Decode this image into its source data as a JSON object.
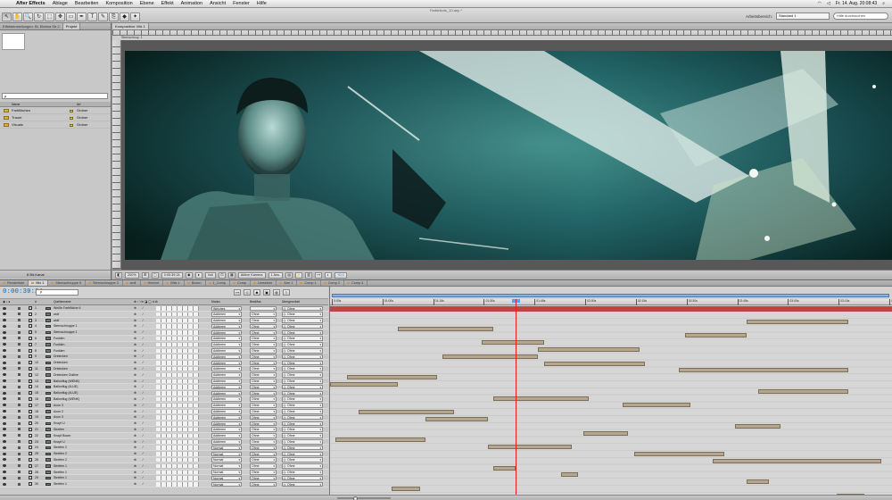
{
  "menubar": {
    "apple": "",
    "items": [
      "After Effects",
      "Ablage",
      "Bearbeiten",
      "Komposition",
      "Ebene",
      "Effekt",
      "Animation",
      "Ansicht",
      "Fenster",
      "Hilfe"
    ],
    "clock": "Fr. 14. Aug. 20:08:43"
  },
  "toolbar": {
    "doc_title": "Farbtrikots_10.aep *",
    "workspace_label": "Arbeitsbereich:",
    "workspace_value": "Standard 1",
    "search_placeholder": "Hilfe durchsuchen",
    "tools": [
      "↖",
      "✋",
      "🔍",
      "↻",
      "⬚",
      "✥",
      "▭",
      "✒",
      "T",
      "✎",
      "⎘",
      "◆",
      "✦"
    ]
  },
  "project": {
    "tabs": [
      "Effekteinstellungen: Bl. Elektra Str 2",
      "Projekt"
    ],
    "search_value": "ρ",
    "col_name": "Name",
    "col_type": "Art",
    "items": [
      {
        "name": "Farbflächen",
        "type": "Ordner"
      },
      {
        "name": "Trauer",
        "type": "Ordner"
      },
      {
        "name": "Visuals",
        "type": "Ordner"
      }
    ],
    "footer_bits": "8 Bit-Kanal"
  },
  "comp": {
    "tabs": [
      "Komposition: Mix 1"
    ],
    "subtab": "Sternschnup. 1",
    "footer": {
      "zoom": "200%",
      "timecode": "0:00:39:24",
      "resolution": "Voll",
      "camera": "Aktive Kamera",
      "views": "1 Ans.",
      "exposure": "+0,0"
    }
  },
  "timeline": {
    "tabs": [
      "Renderliste",
      "Mix 1",
      "Sternschnuppe 5",
      "Sternschnuppe 3",
      "wolf",
      "Himmel",
      "Blitz 1",
      "Boxen",
      "1_Comp",
      "Comp",
      "Umsetzer",
      "Arm 1",
      "Comp 1",
      "Comp 2",
      "Comp 3"
    ],
    "timecode": "0:00:39:24",
    "search_placeholder": "ρ",
    "col_headers": {
      "av": "",
      "num": "#",
      "name": "Quellenname",
      "switches": "⊕ ⋆ \\ fx ◪ ◯ ⊙ ⧉",
      "mode": "Modus",
      "trkmat": "BewMas",
      "parent": "Übergeordnet"
    },
    "layers": [
      {
        "num": "1",
        "name": "Weiße Farbfläche 6",
        "mode": "Weiches",
        "ttm": "",
        "parent": "Ohne"
      },
      {
        "num": "2",
        "name": "wolf",
        "mode": "Addieren",
        "ttm": "Ohne",
        "parent": "Ohne"
      },
      {
        "num": "3",
        "name": "wolf",
        "mode": "Addieren",
        "ttm": "Ohne",
        "parent": "Ohne"
      },
      {
        "num": "4",
        "name": "Sternschnuppe 1",
        "mode": "Addieren",
        "ttm": "Ohne",
        "parent": "Ohne"
      },
      {
        "num": "5",
        "name": "Sternschnuppe 1",
        "mode": "Addieren",
        "ttm": "Ohne",
        "parent": "Ohne"
      },
      {
        "num": "6",
        "name": "Funklen",
        "mode": "Addieren",
        "ttm": "Ohne",
        "parent": "Ohne"
      },
      {
        "num": "7",
        "name": "Funklen",
        "mode": "Addieren",
        "ttm": "Ohne",
        "parent": "Ohne"
      },
      {
        "num": "8",
        "name": "Funklen",
        "mode": "Addieren",
        "ttm": "Ohne",
        "parent": "Ohne"
      },
      {
        "num": "9",
        "name": "Dreiecken",
        "mode": "Addieren",
        "ttm": "Ohne",
        "parent": "Ohne"
      },
      {
        "num": "10",
        "name": "Dreiecken",
        "mode": "Addieren",
        "ttm": "Ohne",
        "parent": "Ohne"
      },
      {
        "num": "11",
        "name": "Dreiecken",
        "mode": "Addieren",
        "ttm": "Ohne",
        "parent": "Ohne"
      },
      {
        "num": "12",
        "name": "Dreiecken Outline",
        "mode": "Addieren",
        "ttm": "Ohne",
        "parent": "Ohne"
      },
      {
        "num": "13",
        "name": "Ballonflug (WENK)",
        "mode": "Addieren",
        "ttm": "Ohne",
        "parent": "Ohne"
      },
      {
        "num": "14",
        "name": "Ballonflug (4LUE)",
        "mode": "Addieren",
        "ttm": "Ohne",
        "parent": "Ohne"
      },
      {
        "num": "15",
        "name": "Ballonflug (4LUE)",
        "mode": "Addieren",
        "ttm": "Ohne",
        "parent": "Ohne"
      },
      {
        "num": "16",
        "name": "Ballonflug (WENK)",
        "mode": "Addieren",
        "ttm": "Ohne",
        "parent": "Ohne"
      },
      {
        "num": "17",
        "name": "Acon 3",
        "mode": "Addieren",
        "ttm": "Ohne",
        "parent": "Ohne"
      },
      {
        "num": "18",
        "name": "Acon 2",
        "mode": "Addieren",
        "ttm": "Ohne",
        "parent": "Ohne"
      },
      {
        "num": "19",
        "name": "Acon 3",
        "mode": "Addieren",
        "ttm": "Ohne",
        "parent": "Ohne"
      },
      {
        "num": "20",
        "name": "Knopf U",
        "mode": "Addieren",
        "ttm": "Ohne",
        "parent": "Ohne"
      },
      {
        "num": "21",
        "name": "Streifen",
        "mode": "Addieren",
        "ttm": "Ohne",
        "parent": "Ohne"
      },
      {
        "num": "22",
        "name": "Knopf Boom",
        "mode": "Addieren",
        "ttm": "Ohne",
        "parent": "Ohne"
      },
      {
        "num": "23",
        "name": "Knopf U",
        "mode": "Addieren",
        "ttm": "Ohne",
        "parent": "Ohne"
      },
      {
        "num": "24",
        "name": "Streifen 2",
        "mode": "Normal",
        "ttm": "Ohne",
        "parent": "Ohne"
      },
      {
        "num": "25",
        "name": "Streifen 2",
        "mode": "Normal",
        "ttm": "Ohne",
        "parent": "Ohne"
      },
      {
        "num": "26",
        "name": "Streifen 2",
        "mode": "Normal",
        "ttm": "Ohne",
        "parent": "Ohne"
      },
      {
        "num": "27",
        "name": "Streifen 1",
        "mode": "Normal",
        "ttm": "Ohne",
        "parent": "Ohne"
      },
      {
        "num": "28",
        "name": "Streifen 1",
        "mode": "Normal",
        "ttm": "Ohne",
        "parent": "Ohne"
      },
      {
        "num": "29",
        "name": "Streifen 1",
        "mode": "Normal",
        "ttm": "Ohne",
        "parent": "Ohne"
      },
      {
        "num": "30",
        "name": "Streifen 1",
        "mode": "Normal",
        "ttm": "Ohne",
        "parent": "Ohne"
      }
    ],
    "ruler_ticks": [
      "0:00s",
      "01:00s",
      "01:15s",
      "01:30s",
      "01:45s",
      "02:00s",
      "02:15s",
      "02:30s",
      "02:45s",
      "03:00s",
      "03:15s",
      "03:30s"
    ],
    "tracks": [
      {
        "s": 0.0,
        "e": 1.0,
        "active": true
      },
      {
        "s": 0.74,
        "e": 0.92
      },
      {
        "s": 0.12,
        "e": 0.29
      },
      {
        "s": 0.63,
        "e": 0.74
      },
      {
        "s": 0.27,
        "e": 0.38
      },
      {
        "s": 0.37,
        "e": 0.55
      },
      {
        "s": 0.2,
        "e": 0.37
      },
      {
        "s": 0.38,
        "e": 0.56
      },
      {
        "s": 0.62,
        "e": 0.92
      },
      {
        "s": 0.03,
        "e": 0.19
      },
      {
        "s": 0.0,
        "e": 0.12
      },
      {
        "s": 0.76,
        "e": 0.92
      },
      {
        "s": 0.29,
        "e": 0.46
      },
      {
        "s": 0.52,
        "e": 0.64
      },
      {
        "s": 0.05,
        "e": 0.22
      },
      {
        "s": 0.17,
        "e": 0.28
      },
      {
        "s": 0.72,
        "e": 0.8
      },
      {
        "s": 0.45,
        "e": 0.53
      },
      {
        "s": 0.01,
        "e": 0.17
      },
      {
        "s": 0.28,
        "e": 0.43
      },
      {
        "s": 0.54,
        "e": 0.7
      },
      {
        "s": 0.68,
        "e": 0.98
      },
      {
        "s": 0.29,
        "e": 0.33
      },
      {
        "s": 0.41,
        "e": 0.44
      },
      {
        "s": 0.74,
        "e": 0.78
      },
      {
        "s": 0.11,
        "e": 0.16
      },
      {
        "s": 0.9,
        "e": 0.95
      },
      {
        "s": 0.8,
        "e": 0.84
      },
      {
        "s": 0.33,
        "e": 0.37
      },
      {
        "s": 0.21,
        "e": 0.26
      }
    ],
    "playhead_fraction": 0.33
  }
}
